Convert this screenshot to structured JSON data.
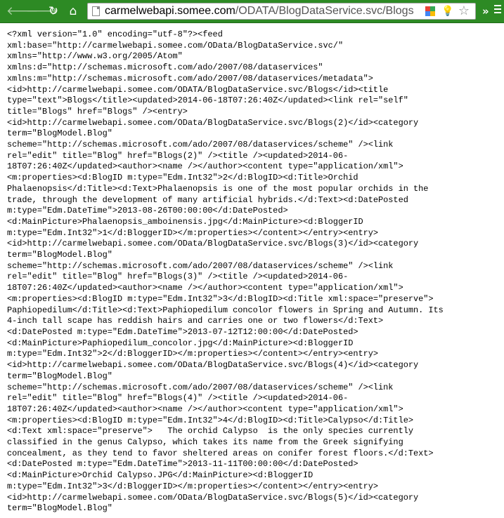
{
  "browser": {
    "url_host": "carmelwebapi.somee.com",
    "url_path": "/ODATA/BlogDataService.svc/Blogs",
    "back_glyph": "🡐",
    "forward_glyph": "🡒",
    "reload_glyph": "↻",
    "home_glyph": "⌂",
    "star_glyph": "☆",
    "ext_glyph": "💡",
    "more_glyph": "»",
    "icons": [
      "back-icon",
      "forward-icon",
      "reload-icon",
      "home-icon",
      "page-icon",
      "extension-icon",
      "lightbulb-icon",
      "star-icon",
      "more-icon",
      "menu-icon"
    ],
    "colors": {
      "toolbar": "#2d8a24",
      "ext_a": [
        "#e94235",
        "#34a853",
        "#4285f4",
        "#fbbc05"
      ]
    }
  },
  "document": {
    "lines": [
      "<?xml version=\"1.0\" encoding=\"utf-8\"?><feed",
      "xml:base=\"http://carmelwebapi.somee.com/OData/BlogDataService.svc/\"",
      "xmlns=\"http://www.w3.org/2005/Atom\"",
      "xmlns:d=\"http://schemas.microsoft.com/ado/2007/08/dataservices\"",
      "xmlns:m=\"http://schemas.microsoft.com/ado/2007/08/dataservices/metadata\">",
      "<id>http://carmelwebapi.somee.com/ODATA/BlogDataService.svc/Blogs</id><title",
      "type=\"text\">Blogs</title><updated>2014-06-18T07:26:40Z</updated><link rel=\"self\"",
      "title=\"Blogs\" href=\"Blogs\" /><entry>",
      "<id>http://carmelwebapi.somee.com/OData/BlogDataService.svc/Blogs(2)</id><category",
      "term=\"BlogModel.Blog\"",
      "scheme=\"http://schemas.microsoft.com/ado/2007/08/dataservices/scheme\" /><link",
      "rel=\"edit\" title=\"Blog\" href=\"Blogs(2)\" /><title /><updated>2014-06-",
      "18T07:26:40Z</updated><author><name /></author><content type=\"application/xml\">",
      "<m:properties><d:BlogID m:type=\"Edm.Int32\">2</d:BlogID><d:Title>Orchid",
      "Phalaenopsis</d:Title><d:Text>Phalaenopsis is one of the most popular orchids in the",
      "trade, through the development of many artificial hybrids.</d:Text><d:DatePosted",
      "m:type=\"Edm.DateTime\">2013-08-26T00:00:00</d:DatePosted>",
      "<d:MainPicture>Phalaenopsis_amboinensis.jpg</d:MainPicture><d:BloggerID",
      "m:type=\"Edm.Int32\">1</d:BloggerID></m:properties></content></entry><entry>",
      "<id>http://carmelwebapi.somee.com/OData/BlogDataService.svc/Blogs(3)</id><category",
      "term=\"BlogModel.Blog\"",
      "scheme=\"http://schemas.microsoft.com/ado/2007/08/dataservices/scheme\" /><link",
      "rel=\"edit\" title=\"Blog\" href=\"Blogs(3)\" /><title /><updated>2014-06-",
      "18T07:26:40Z</updated><author><name /></author><content type=\"application/xml\">",
      "<m:properties><d:BlogID m:type=\"Edm.Int32\">3</d:BlogID><d:Title xml:space=\"preserve\">",
      "Paphiopedilum</d:Title><d:Text>Paphiopedilum concolor flowers in Spring and Autumn. Its",
      "4-inch tall scape has reddish hairs and carries one or two flowers</d:Text>",
      "<d:DatePosted m:type=\"Edm.DateTime\">2013-07-12T12:00:00</d:DatePosted>",
      "<d:MainPicture>Paphiopedilum_concolor.jpg</d:MainPicture><d:BloggerID",
      "m:type=\"Edm.Int32\">2</d:BloggerID></m:properties></content></entry><entry>",
      "<id>http://carmelwebapi.somee.com/OData/BlogDataService.svc/Blogs(4)</id><category",
      "term=\"BlogModel.Blog\"",
      "scheme=\"http://schemas.microsoft.com/ado/2007/08/dataservices/scheme\" /><link",
      "rel=\"edit\" title=\"Blog\" href=\"Blogs(4)\" /><title /><updated>2014-06-",
      "18T07:26:40Z</updated><author><name /></author><content type=\"application/xml\">",
      "<m:properties><d:BlogID m:type=\"Edm.Int32\">4</d:BlogID><d:Title>Calypso</d:Title>",
      "<d:Text xml:space=\"preserve\">   The orchid Calypso  is the only species currently",
      "classified in the genus Calypso, which takes its name from the Greek signifying",
      "concealment, as they tend to favor sheltered areas on conifer forest floors.</d:Text>",
      "<d:DatePosted m:type=\"Edm.DateTime\">2013-11-11T00:00:00</d:DatePosted>",
      "<d:MainPicture>Orchid Calypso.JPG</d:MainPicture><d:BloggerID",
      "m:type=\"Edm.Int32\">3</d:BloggerID></m:properties></content></entry><entry>",
      "<id>http://carmelwebapi.somee.com/OData/BlogDataService.svc/Blogs(5)</id><category",
      "term=\"BlogModel.Blog\""
    ]
  }
}
